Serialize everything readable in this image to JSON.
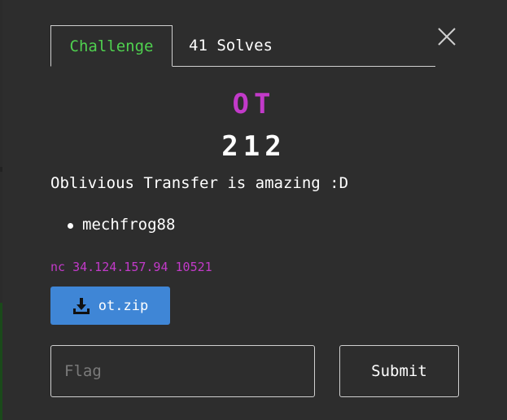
{
  "tabs": [
    {
      "label": "Challenge",
      "active": true
    },
    {
      "label": "41 Solves",
      "active": false
    }
  ],
  "challenge": {
    "name": "OT",
    "points": "212",
    "description": "Oblivious Transfer is amazing :D",
    "authors": [
      "mechfrog88"
    ],
    "connection": "nc 34.124.157.94 10521"
  },
  "download": {
    "label": "ot.zip",
    "icon": "download-icon"
  },
  "flag_input": {
    "placeholder": "Flag",
    "value": ""
  },
  "submit": {
    "label": "Submit"
  },
  "colors": {
    "background": "#2d2d2d",
    "title_accent": "#c23ac9",
    "active_tab": "#4fd14f",
    "download_button": "#3f86d6"
  }
}
